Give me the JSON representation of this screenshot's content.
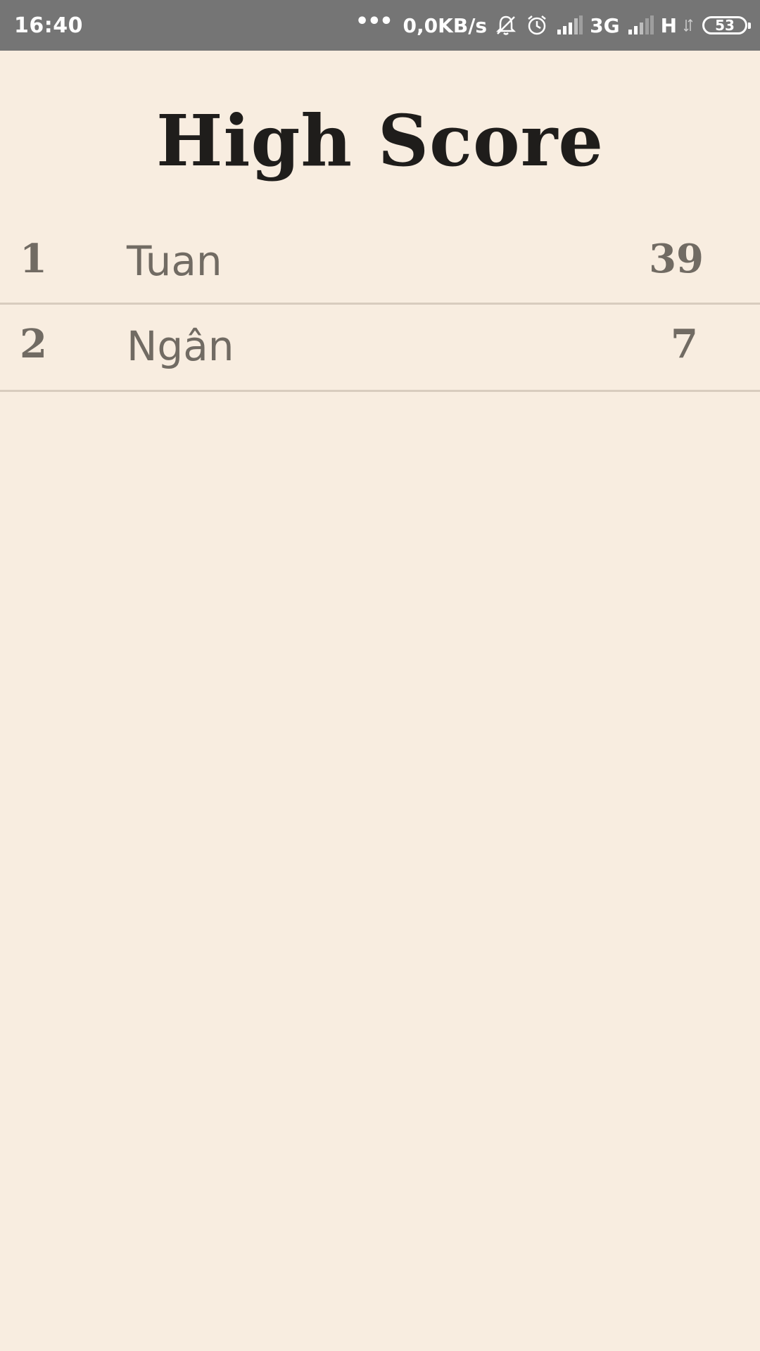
{
  "status_bar": {
    "time": "16:40",
    "dots": "•••",
    "network_speed": "0,0KB/s",
    "network_1": "3G",
    "network_2": "H",
    "battery_level": "53",
    "icons": [
      "silent-notification-icon",
      "alarm-icon",
      "signal-icon",
      "signal-icon",
      "data-arrows-icon",
      "battery-icon"
    ]
  },
  "page": {
    "title": "High Score"
  },
  "scores": [
    {
      "rank": "1",
      "name": "Tuan",
      "score": "39"
    },
    {
      "rank": "2",
      "name": "Ngân",
      "score": "7"
    }
  ],
  "colors": {
    "background": "#f8ede0",
    "status_bar": "#757575",
    "title": "#1f1d1b",
    "row_text": "#716b63",
    "divider": "#d8ccbe"
  }
}
